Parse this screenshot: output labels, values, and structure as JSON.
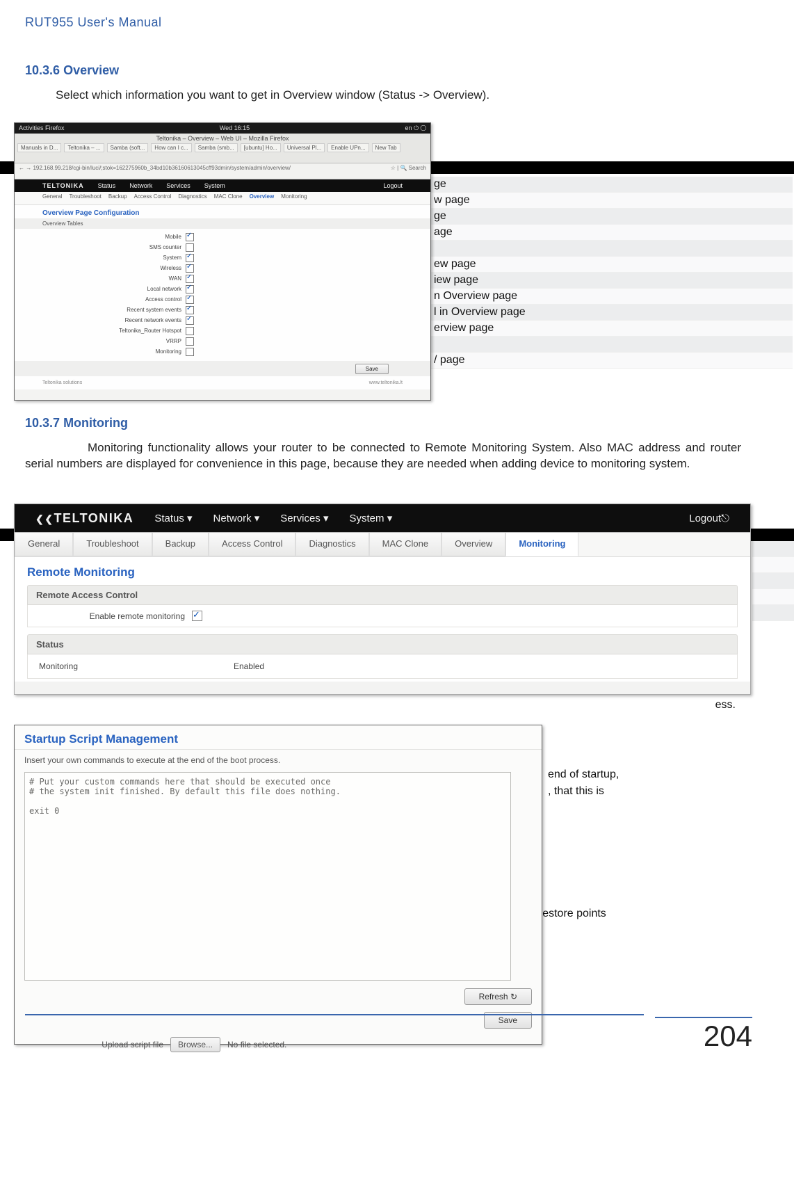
{
  "doc_header": "RUT955 User's Manual",
  "section_1036": {
    "number": "10.3.6",
    "title": "Overview",
    "body": "Select which information you want to get in Overview window (Status -> Overview)."
  },
  "overview_shot": {
    "topbar": {
      "left": "Activities    Firefox",
      "center": "Wed 16:15",
      "right": "en    ⏻ ◯"
    },
    "fx_title": "Teltonika – Overview – Web UI – Mozilla Firefox",
    "tabs": [
      "Manuals in D...",
      "Teltonika – ...",
      "Samba (soft...",
      "How can I c...",
      "Samba (smb...",
      "[ubuntu] Ho...",
      "Universal Pl...",
      "Enable UPn...",
      "New Tab"
    ],
    "address": "192.168.99.218/cgi-bin/luci/;stok=162275960b_34bd10b36160613045cff93dmin/system/admin/overview/",
    "search_label": "Search",
    "router": {
      "logo": "TELTONIKA",
      "menu": [
        "Status",
        "Network",
        "Services",
        "System"
      ],
      "logout": "Logout"
    },
    "subnav": [
      "General",
      "Troubleshoot",
      "Backup",
      "Access Control",
      "Diagnostics",
      "MAC Clone",
      "Overview",
      "Monitoring"
    ],
    "subnav_active_index": 6,
    "title": "Overview Page Configuration",
    "section_label": "Overview Tables",
    "form_rows": [
      {
        "label": "Mobile",
        "checked": true
      },
      {
        "label": "SMS counter",
        "checked": false
      },
      {
        "label": "System",
        "checked": true
      },
      {
        "label": "Wireless",
        "checked": true
      },
      {
        "label": "WAN",
        "checked": true
      },
      {
        "label": "Local network",
        "checked": true
      },
      {
        "label": "Access control",
        "checked": true
      },
      {
        "label": "Recent system events",
        "checked": true
      },
      {
        "label": "Recent network events",
        "checked": true
      },
      {
        "label": "Teltonika_Router Hotspot",
        "checked": false
      },
      {
        "label": "VRRP",
        "checked": false
      },
      {
        "label": "Monitoring",
        "checked": false
      }
    ],
    "save_btn": "Save",
    "footer_left": "Teltonika solutions",
    "footer_right": "www.teltonika.lt"
  },
  "partial_lines_1": [
    "ge",
    "w page",
    "ge",
    "age",
    "",
    "ew page",
    "iew page",
    "n Overview page",
    "l in Overview page",
    "erview page",
    "",
    "/ page"
  ],
  "section_1037": {
    "number": "10.3.7",
    "title": "Monitoring",
    "body": "Monitoring functionality allows your router to be connected to Remote Monitoring System. Also MAC address and router serial numbers are displayed for convenience in this page, because they are needed when adding device to monitoring system."
  },
  "mon_shot": {
    "router": {
      "logo": "TELTONIKA",
      "menu": [
        "Status",
        "Network",
        "Services",
        "System"
      ],
      "logout": "Logout"
    },
    "subnav": [
      "General",
      "Troubleshoot",
      "Backup",
      "Access Control",
      "Diagnostics",
      "MAC Clone",
      "Overview",
      "Monitoring"
    ],
    "subnav_active_index": 7,
    "h": "Remote Monitoring",
    "acc_head": "Remote Access Control",
    "acc_label": "Enable remote monitoring",
    "acc_checked": true,
    "status_head": "Status",
    "status_c1": "Monitoring",
    "status_c2": "Enabled"
  },
  "partial_lines_2": [
    "",
    "",
    "",
    "",
    "",
    "ess."
  ],
  "ssm_shot": {
    "title": "Startup Script Management",
    "desc": "Insert your own commands to execute at the end of the boot process.",
    "textarea": "# Put your custom commands here that should be executed once\n# the system init finished. By default this file does nothing.\n\nexit 0",
    "refresh_btn": "Refresh",
    "refresh_icon": "↻",
    "save_btn": "Save",
    "upload_label": "Upload script file",
    "browse_btn": "Browse...",
    "no_file": "No file selected."
  },
  "right_fragments": {
    "end_of_startup": "end of startup,",
    "that_this_is": ", that this is",
    "figurations": "figurations. You can download created restore points"
  },
  "page_number": "204"
}
